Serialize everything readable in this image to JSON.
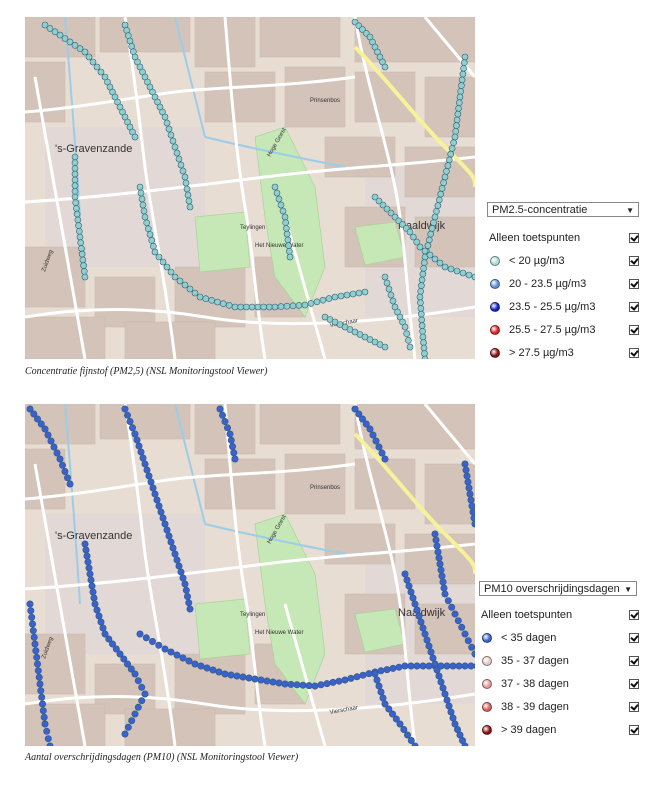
{
  "maps": [
    {
      "id": "pm25",
      "caption": "Concentratie fijnstof (PM2,5) (NSL Monitoringstool Viewer)",
      "place_labels": [
        "'s-Gravenzande",
        "Naaldwijk"
      ],
      "street_labels": [
        "Hoge Geest",
        "Teylingen",
        "Het Nieuwe Water",
        "Prinsenbos",
        "Vierschaar",
        "Zuidweg"
      ],
      "marker_color": "#8fd0cd",
      "legend": {
        "select_value": "PM2.5-concentratie",
        "only_points_label": "Alleen toetspunten",
        "classes": [
          {
            "label": "< 20 µg/m3",
            "color": "#a9dcd9"
          },
          {
            "label": "20 - 23.5 µg/m3",
            "color": "#5f8fd6"
          },
          {
            "label": "23.5 - 25.5 µg/m3",
            "color": "#1020c8"
          },
          {
            "label": "25.5 - 27.5 µg/m3",
            "color": "#e02020"
          },
          {
            "label": "> 27.5 µg/m3",
            "color": "#8b1010"
          }
        ]
      }
    },
    {
      "id": "pm10",
      "caption": "Aantal overschrijdingsdagen (PM10) (NSL Monitoringstool Viewer)",
      "place_labels": [
        "'s-Gravenzande",
        "Naaldwijk"
      ],
      "street_labels": [
        "Hoge Geest",
        "Teylingen",
        "Het Nieuwe Water",
        "Prinsenbos",
        "Vierschaar",
        "Zuidweg"
      ],
      "marker_color": "#3a62cf",
      "legend": {
        "select_value": "PM10 overschrijdingsdagen",
        "only_points_label": "Alleen toetspunten",
        "classes": [
          {
            "label": "< 35 dagen",
            "color": "#3a62cf"
          },
          {
            "label": "35 - 37 dagen",
            "color": "#e6c8c8"
          },
          {
            "label": "37 - 38 dagen",
            "color": "#e29a9a"
          },
          {
            "label": "38 - 39 dagen",
            "color": "#d86060"
          },
          {
            "label": "> 39 dagen",
            "color": "#8b1010"
          }
        ]
      }
    }
  ]
}
